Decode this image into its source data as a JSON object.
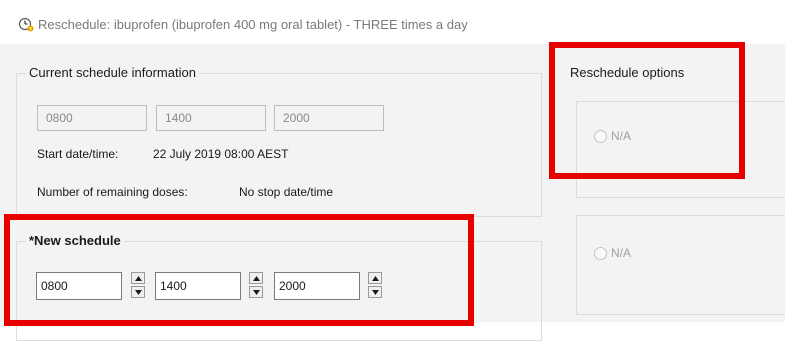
{
  "window": {
    "title": "Reschedule: ibuprofen (ibuprofen 400 mg oral tablet) -  THREE times a day",
    "icon": "clock-icon"
  },
  "current_schedule": {
    "legend": "Current schedule information",
    "times": [
      "0800",
      "1400",
      "2000"
    ],
    "start_label": "Start date/time:",
    "start_value": "22 July 2019 08:00 AEST",
    "remaining_label": "Number of remaining doses:",
    "remaining_value": "No stop date/time"
  },
  "new_schedule": {
    "legend": "*New schedule",
    "times": [
      "0800",
      "1400",
      "2000"
    ]
  },
  "reschedule_options": {
    "legend": "Reschedule options",
    "options": [
      {
        "label": "N/A",
        "selected": false
      },
      {
        "label": "N/A",
        "selected": false
      }
    ]
  },
  "colors": {
    "highlight": "#e60000",
    "background": "#f3f3f3"
  }
}
